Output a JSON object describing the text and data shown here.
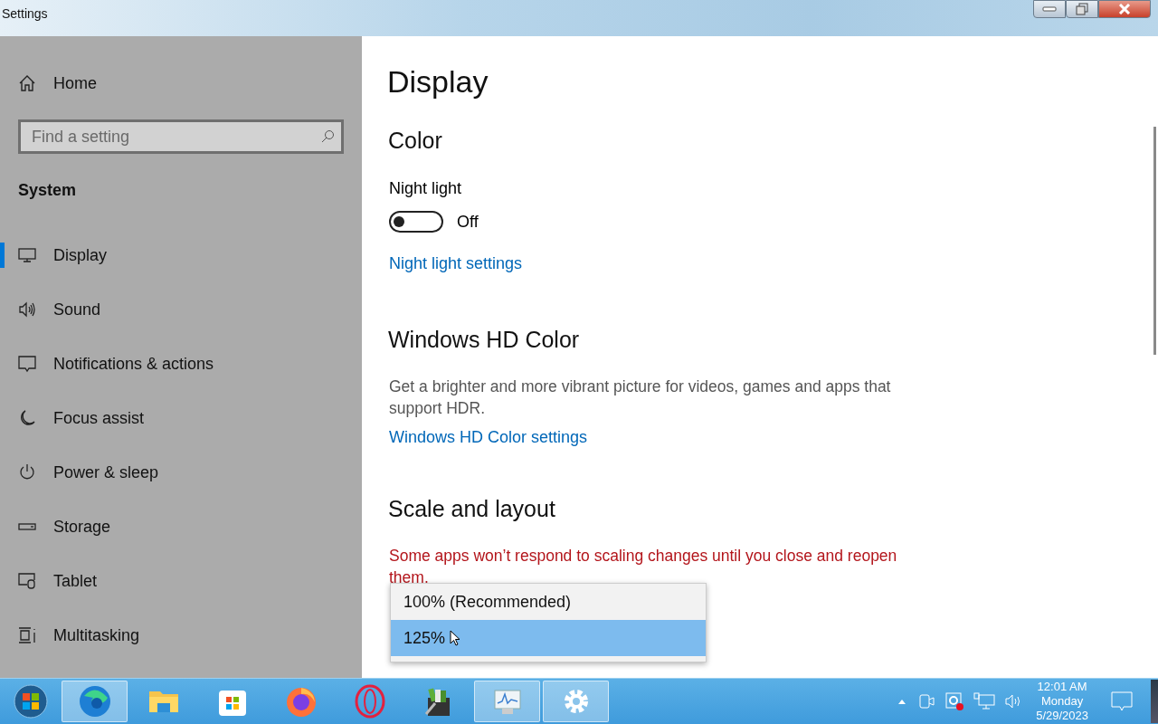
{
  "window": {
    "title": "Settings"
  },
  "sidebar": {
    "home": "Home",
    "search": {
      "placeholder": "Find a setting"
    },
    "section": "System",
    "items": [
      {
        "label": "Display",
        "selected": true
      },
      {
        "label": "Sound",
        "selected": false
      },
      {
        "label": "Notifications & actions",
        "selected": false
      },
      {
        "label": "Focus assist",
        "selected": false
      },
      {
        "label": "Power & sleep",
        "selected": false
      },
      {
        "label": "Storage",
        "selected": false
      },
      {
        "label": "Tablet",
        "selected": false
      },
      {
        "label": "Multitasking",
        "selected": false
      }
    ]
  },
  "content": {
    "title": "Display",
    "color_heading": "Color",
    "night_light": {
      "label": "Night light",
      "on": false,
      "state_text": "Off"
    },
    "night_light_link": "Night light settings",
    "hd_heading": "Windows HD Color",
    "hd_description": "Get a brighter and more vibrant picture for videos, games and apps that support HDR.",
    "hd_link": "Windows HD Color settings",
    "scale_heading": "Scale and layout",
    "scale_warning": "Some apps won’t respond to scaling changes until you close and reopen them."
  },
  "dropdown": {
    "options": [
      {
        "label": "100% (Recommended)",
        "selected": false
      },
      {
        "label": "125%",
        "selected": true
      }
    ]
  },
  "taskbar": {
    "apps": [
      {
        "highlighted": true
      },
      {
        "highlighted": false
      },
      {
        "highlighted": false
      },
      {
        "highlighted": false
      },
      {
        "highlighted": false
      },
      {
        "highlighted": false
      },
      {
        "highlighted": true
      },
      {
        "highlighted": true
      }
    ],
    "clock": {
      "time": "12:01 AM",
      "day": "Monday",
      "date": "5/29/2023"
    }
  }
}
